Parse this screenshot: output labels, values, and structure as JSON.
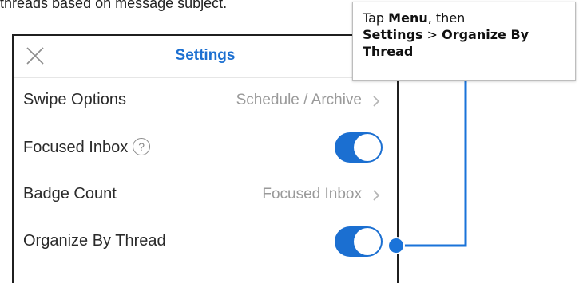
{
  "intro_text": "threads based on message subject.",
  "navbar": {
    "title": "Settings",
    "close_icon": "close-icon"
  },
  "rows": [
    {
      "label": "Swipe Options",
      "value": "Schedule / Archive"
    },
    {
      "label": "Focused Inbox",
      "toggle_on": true
    },
    {
      "label": "Badge Count",
      "value": "Focused Inbox"
    },
    {
      "label": "Organize By Thread",
      "toggle_on": true
    }
  ],
  "callout": {
    "p1": "Tap ",
    "menu": "Menu",
    "p2": ", then",
    "settings": "Settings",
    "sep": " > ",
    "organize": "Organize By Thread"
  },
  "colors": {
    "accent": "#1b6fd1",
    "toggle_on": "#1b6fd1",
    "connector": "#1a73d9"
  }
}
